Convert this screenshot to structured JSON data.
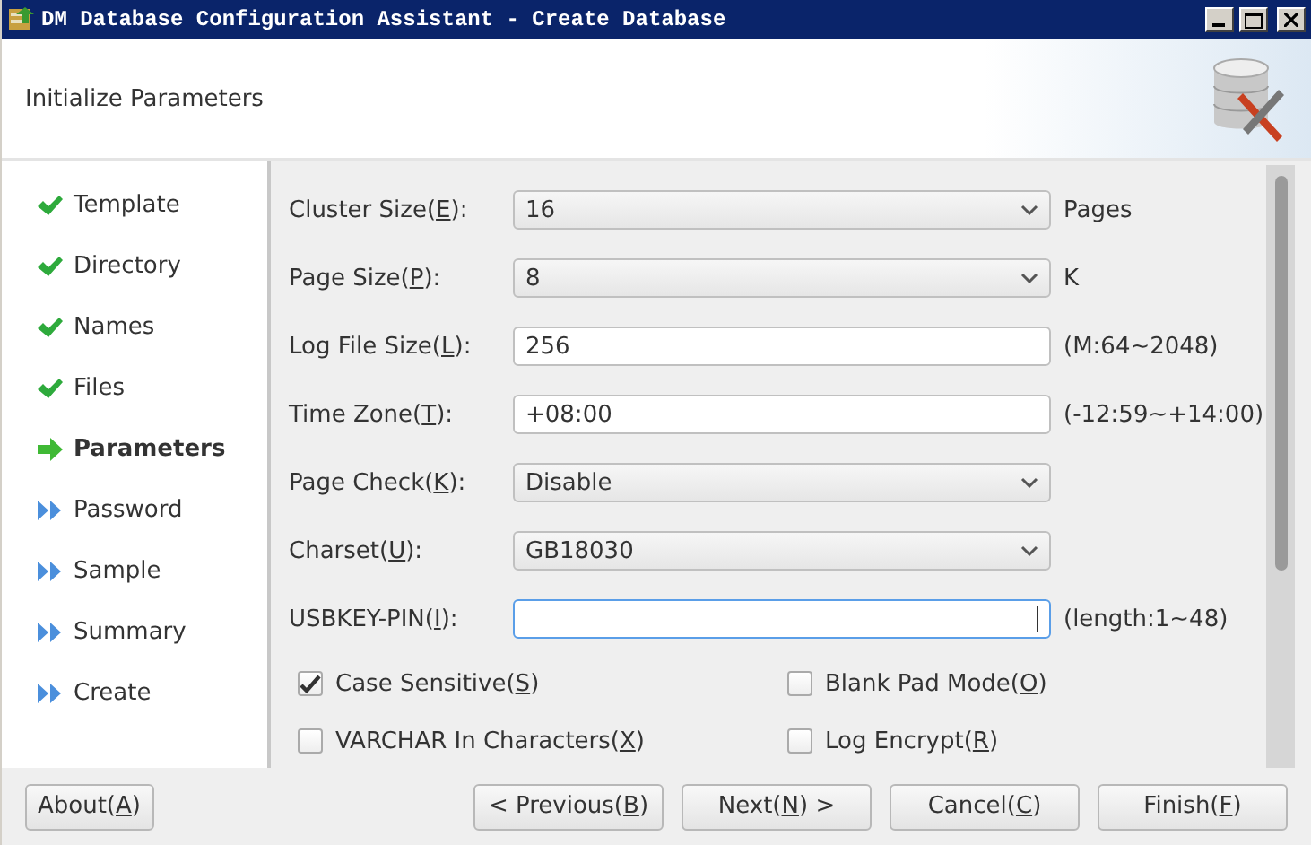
{
  "window": {
    "title": "DM Database Configuration Assistant - Create Database"
  },
  "header": {
    "title": "Initialize Parameters"
  },
  "sidebar": {
    "items": [
      {
        "label": "Template",
        "kind": "done"
      },
      {
        "label": "Directory",
        "kind": "done"
      },
      {
        "label": "Names",
        "kind": "done"
      },
      {
        "label": "Files",
        "kind": "done"
      },
      {
        "label": "Parameters",
        "kind": "current"
      },
      {
        "label": "Password",
        "kind": "pending"
      },
      {
        "label": "Sample",
        "kind": "pending"
      },
      {
        "label": "Summary",
        "kind": "pending"
      },
      {
        "label": "Create",
        "kind": "pending"
      }
    ]
  },
  "fields": [
    {
      "label": {
        "before": "Cluster Size(",
        "key": "E",
        "after": "):"
      },
      "kind": "select",
      "value": "16",
      "suffix": "Pages",
      "focused": false
    },
    {
      "label": {
        "before": "Page Size(",
        "key": "P",
        "after": "):"
      },
      "kind": "select",
      "value": "8",
      "suffix": "K",
      "focused": false
    },
    {
      "label": {
        "before": "Log File Size(",
        "key": "L",
        "after": "):"
      },
      "kind": "text",
      "value": "256",
      "suffix": "(M:64~2048)",
      "focused": false
    },
    {
      "label": {
        "before": "Time Zone(",
        "key": "T",
        "after": "):"
      },
      "kind": "text",
      "value": "+08:00",
      "suffix": "(-12:59~+14:00)",
      "focused": false
    },
    {
      "label": {
        "before": "Page Check(",
        "key": "K",
        "after": "):"
      },
      "kind": "select",
      "value": "Disable",
      "focused": false
    },
    {
      "label": {
        "before": "Charset(",
        "key": "U",
        "after": "):"
      },
      "kind": "select",
      "value": "GB18030",
      "focused": false
    },
    {
      "label": {
        "before": "USBKEY-PIN(",
        "key": "I",
        "after": "):"
      },
      "kind": "text",
      "suffix": "(length:1~48)",
      "focused": true
    }
  ],
  "checkboxes": [
    {
      "label": {
        "before": "Case Sensitive(",
        "key": "S",
        "after": ")"
      },
      "checked": true
    },
    {
      "label": {
        "before": "Blank Pad Mode(",
        "key": "O",
        "after": ")"
      },
      "checked": false
    },
    {
      "label": {
        "before": "VARCHAR In Characters(",
        "key": "X",
        "after": ")"
      },
      "checked": false
    },
    {
      "label": {
        "before": "Log Encrypt(",
        "key": "R",
        "after": ")"
      },
      "checked": false
    }
  ],
  "buttons": [
    {
      "label": {
        "before": "About(",
        "key": "A",
        "after": ")"
      },
      "kind": "left"
    },
    {
      "label": {
        "before": "< Previous(",
        "key": "B",
        "after": ")"
      },
      "kind": "right"
    },
    {
      "label": {
        "before": "Next(",
        "key": "N",
        "after": ") >"
      },
      "kind": "right"
    },
    {
      "label": {
        "before": "Cancel(",
        "key": "C",
        "after": ")"
      },
      "kind": "right"
    },
    {
      "label": {
        "before": "Finish(",
        "key": "F",
        "after": ")"
      },
      "kind": "right"
    }
  ]
}
